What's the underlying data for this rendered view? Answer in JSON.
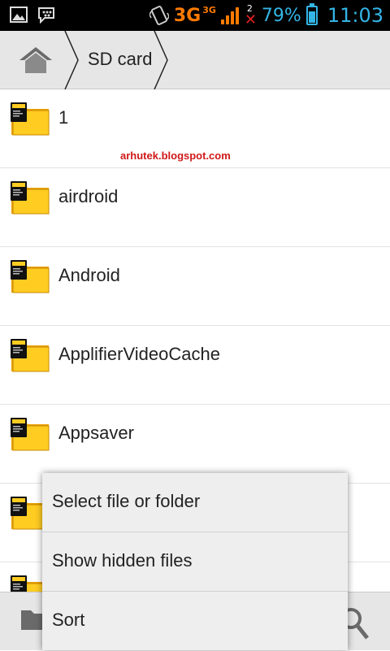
{
  "status_bar": {
    "network_type": "3G",
    "network_type_secondary": "3G",
    "sim2_number": "2",
    "battery_percent": "79%",
    "battery_level": 0.79,
    "time": "11:03",
    "colors": {
      "accent": "#33b5e5",
      "network": "#ff7a00",
      "no_signal": "#e02020"
    }
  },
  "breadcrumb": {
    "home_icon": "home-icon",
    "current": "SD card"
  },
  "watermark": "arhutek.blogspot.com",
  "folders": [
    {
      "name": "1"
    },
    {
      "name": "airdroid"
    },
    {
      "name": "Android"
    },
    {
      "name": "ApplifierVideoCache"
    },
    {
      "name": "Appsaver"
    },
    {
      "name": ""
    },
    {
      "name": ""
    }
  ],
  "bottom_bar": {
    "left_icon": "folder-icon",
    "right_icon": "search-icon"
  },
  "menu": {
    "items": [
      {
        "label": "Select file or folder"
      },
      {
        "label": "Show hidden files"
      },
      {
        "label": "Sort"
      }
    ]
  }
}
